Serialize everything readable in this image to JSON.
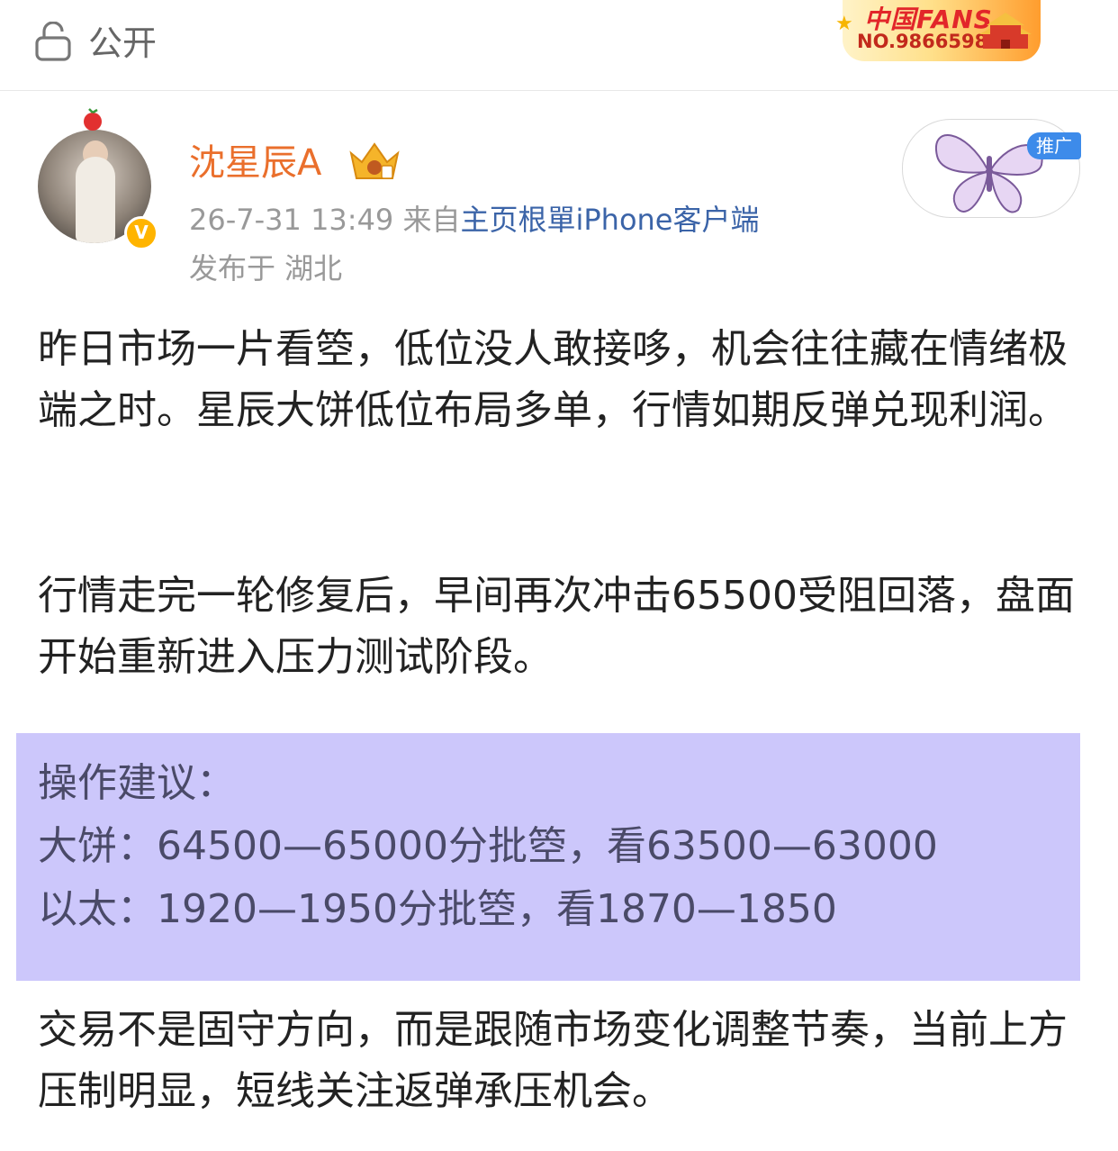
{
  "header": {
    "visibility_label": "公开",
    "lock_icon": "lock-icon",
    "fans_badge": {
      "title": "中国FANS",
      "number": "NO.9866598"
    }
  },
  "post": {
    "author": "沈星辰A",
    "timestamp": "26-7-31 13:49",
    "source_prefix": "来自",
    "source": "主页根單iPhone客户端",
    "location": "发布于 湖北",
    "promo_tag": "推广",
    "paragraphs": [
      "昨日市场一片看箜，低位没人敢接哆，机会往往藏在情绪极端之时。星辰大饼低位布局多单，行情如期反弹兑现利润。",
      "行情走完一轮修复后，早间再次冲击65500受阻回落，盘面开始重新进入压力测试阶段。",
      "交易不是固守方向，而是跟随市场变化调整节奏，当前上方压制明显，短线关注返弹承压机会。"
    ],
    "advice": {
      "title": "操作建议：",
      "line1": "大饼：64500—65000分批箜，看63500—63000",
      "line2": "以太：1920—1950分批箜，看1870—1850"
    }
  },
  "colors": {
    "username": "#ea6f2c",
    "source_link": "#3b64a8",
    "advice_bg": "#ccc7fb",
    "promo_tag": "#3d8bea",
    "verified": "#ffb400"
  }
}
